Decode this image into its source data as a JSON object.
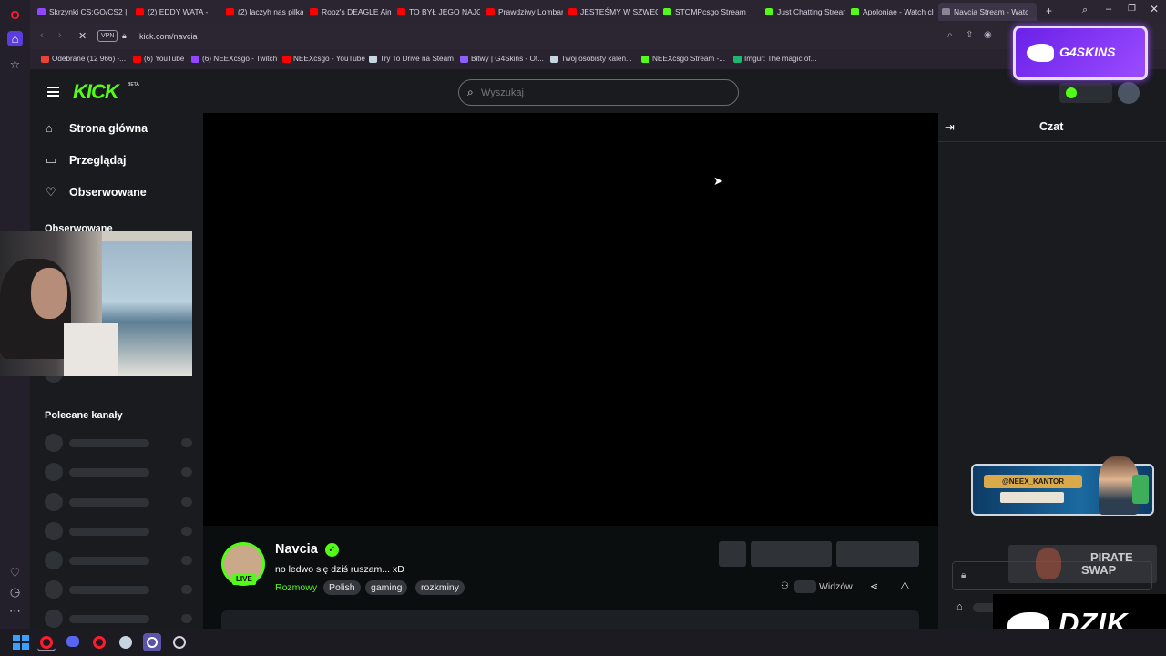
{
  "browser": {
    "tabs": [
      {
        "label": "Skrzynki CS:GO/CS2 |",
        "color": "#9146ff"
      },
      {
        "label": "(2) EDDY WATA - ",
        "color": "#ff0000"
      },
      {
        "label": "(2) laczyh nas pilka - Y",
        "color": "#ff0000"
      },
      {
        "label": "Ropz's DEAGLE Aim in",
        "color": "#ff0000"
      },
      {
        "label": "TO BYŁ JEGO NAJGOR",
        "color": "#ff0000"
      },
      {
        "label": "Prawdziwy Lombard -",
        "color": "#ff0000"
      },
      {
        "label": "JESTEŚMY W SZWECJ",
        "color": "#ff0000"
      },
      {
        "label": "STOMPcsgo Stream -",
        "color": "#53fc18"
      },
      {
        "label": "Just Chatting Stream",
        "color": "#53fc18"
      },
      {
        "label": "Apoloniae - Watch cli",
        "color": "#53fc18"
      },
      {
        "label": "Navcia Stream - Watc",
        "color": "#8a8596"
      }
    ],
    "url": "kick.com/navcia",
    "vpn_label": "VPN",
    "bookmarks": [
      {
        "label": "Odebrane (12 966) -...",
        "color": "#ea4335"
      },
      {
        "label": "(6) YouTube",
        "color": "#ff0000"
      },
      {
        "label": "(6) NEEXcsgo - Twitch",
        "color": "#9146ff"
      },
      {
        "label": "NEEXcsgo - YouTube",
        "color": "#ff0000"
      },
      {
        "label": "Try To Drive na Steam",
        "color": "#c7d5e0"
      },
      {
        "label": "Bitwy | G4Skins - Ot...",
        "color": "#8e5cff"
      },
      {
        "label": "Twój osobisty kalen...",
        "color": "#c7d5e0"
      },
      {
        "label": "NEEXcsgo Stream -...",
        "color": "#53fc18"
      },
      {
        "label": "Imgur: The magic of...",
        "color": "#1bb76e"
      }
    ]
  },
  "kick": {
    "logo": "KICK",
    "logo_badge": "BETA",
    "search_placeholder": "Wyszukaj",
    "nav": [
      "Strona główna",
      "Przeglądaj",
      "Obserwowane"
    ],
    "followed_heading": "Obserwowane",
    "recommended_heading": "Polecane kanały",
    "chat_title": "Czat",
    "streamer": {
      "name": "Navcia",
      "title": "no ledwo się dziś ruszam... xD",
      "category": "Rozmowy",
      "tags": [
        "Polish",
        "gaming",
        "rozkminy"
      ],
      "live_badge": "LIVE",
      "viewers_label": "Widzów"
    }
  },
  "overlays": {
    "g4skins": "G4SKINS",
    "neex_handle": "@NEEX_KANTOR",
    "pirateswap_top": "PIRATE",
    "pirateswap_bottom": "SWAP",
    "dzik": "DZIK"
  },
  "colors": {
    "kick_green": "#53fc18",
    "opera_red": "#ff1b2d",
    "g4_purple": "#7b2cf5"
  }
}
